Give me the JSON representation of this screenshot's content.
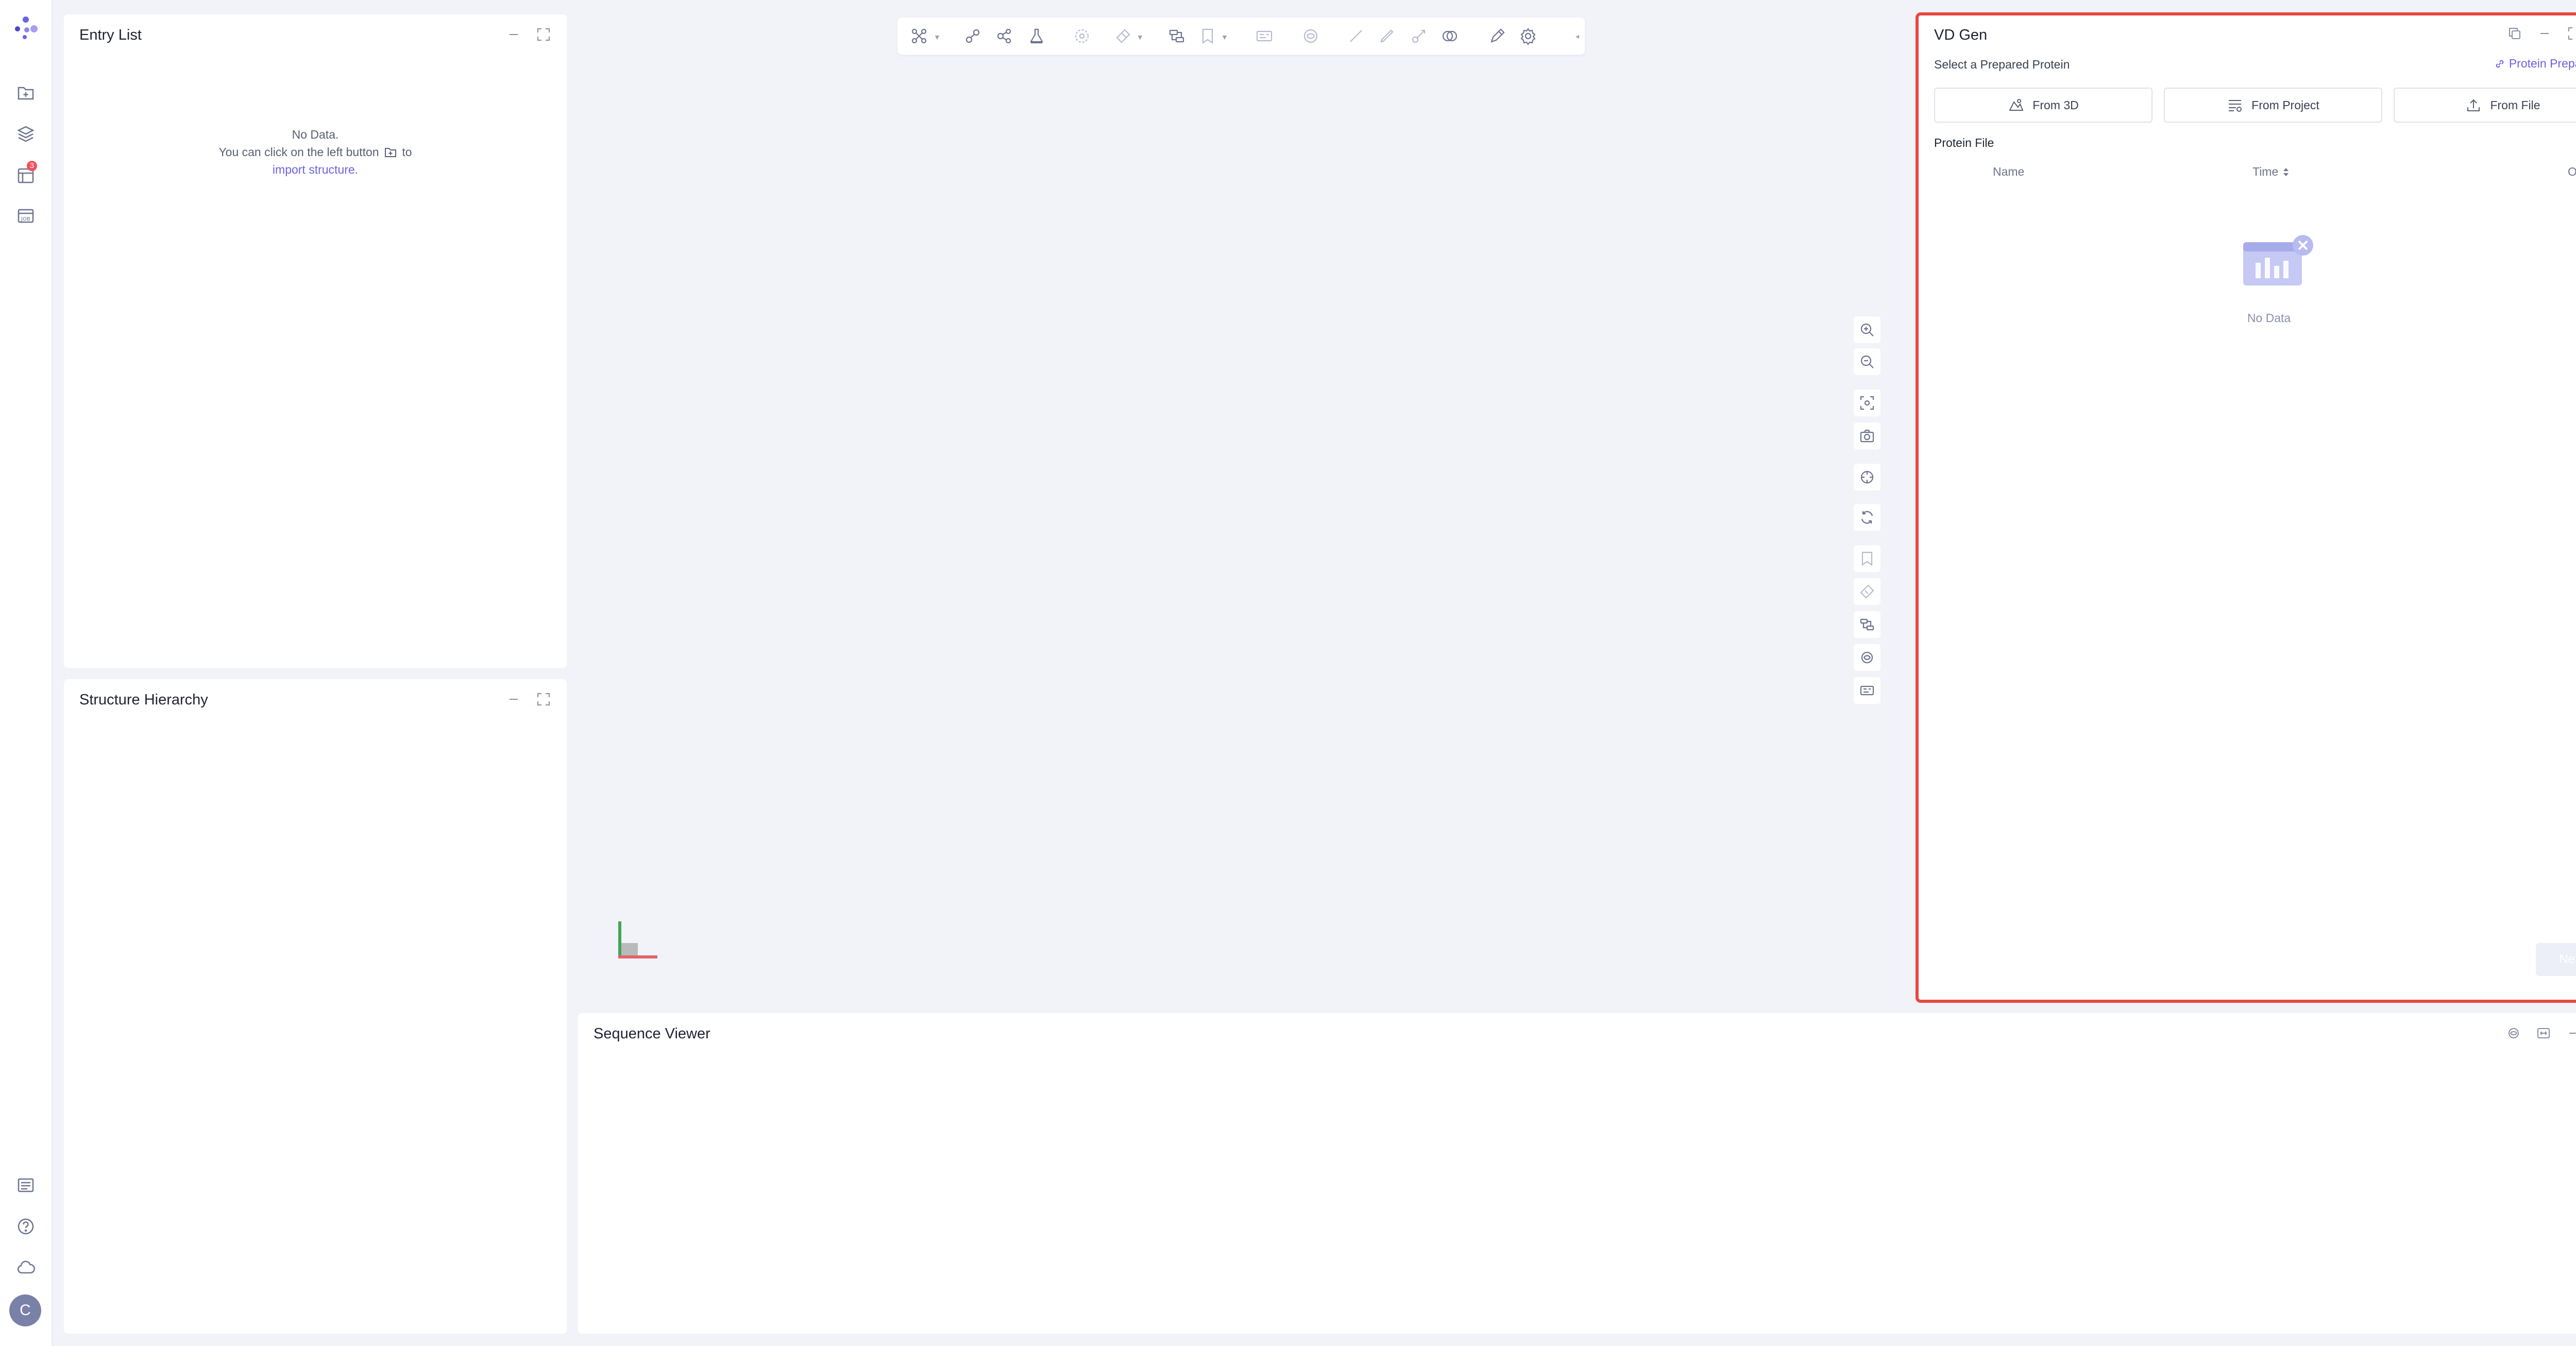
{
  "entry_list": {
    "title": "Entry List",
    "no_data": "No Data.",
    "hint_before": "You can click on the left button",
    "hint_after": "to",
    "import_link": "import structure."
  },
  "structure_hierarchy": {
    "title": "Structure Hierarchy"
  },
  "sequence_viewer": {
    "title": "Sequence Viewer"
  },
  "rail": {
    "badge_count": "3",
    "avatar_letter": "C"
  },
  "vd_gen": {
    "title": "VD Gen",
    "select_label": "Select a Prepared Protein",
    "protein_prep_link": "Protein Preparation",
    "buttons": [
      "From 3D",
      "From Project",
      "From File"
    ],
    "section_label": "Protein File",
    "columns": {
      "name": "Name",
      "time": "Time",
      "operation": "Operation"
    },
    "empty_text": "No Data",
    "next": "Next"
  },
  "colors": {
    "accent": "#6b63e0",
    "highlight_border": "#e8483f",
    "badge": "#f5505b"
  },
  "icons": {
    "rail": [
      "logo-icon",
      "new-project-icon",
      "layers-icon",
      "tasks-icon",
      "jobs-icon",
      "log-icon",
      "help-icon",
      "cloud-icon"
    ],
    "toolbar": [
      "atom-style-icon",
      "bond-icon",
      "molecule-icon",
      "flask-icon",
      "select-icon",
      "tag-icon",
      "surface-icon",
      "bookmark-icon",
      "label-icon",
      "hbond-icon",
      "line-icon",
      "pencil-line-icon",
      "wand-icon",
      "eye-icon",
      "edit-icon",
      "gear-icon"
    ],
    "side": [
      "zoom-in-icon",
      "zoom-out-icon",
      "fit-icon",
      "camera-icon",
      "center-icon",
      "rotate-icon",
      "bookmark-icon",
      "measure-icon",
      "surface-icon",
      "hbond-icon",
      "label-icon"
    ]
  }
}
